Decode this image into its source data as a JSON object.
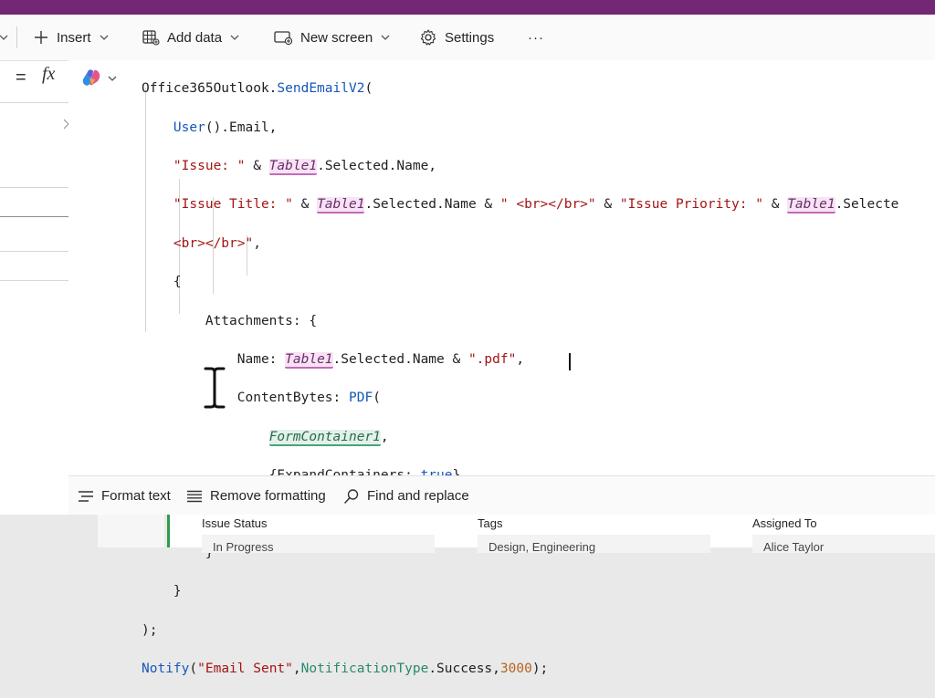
{
  "toolbar": {
    "insert_label": "Insert",
    "add_data_label": "Add data",
    "new_screen_label": "New screen",
    "settings_label": "Settings",
    "more_label": "···"
  },
  "formula_bar": {
    "equals": "=",
    "fx": "fx"
  },
  "bottom_bar": {
    "format_text_label": "Format text",
    "remove_formatting_label": "Remove formatting",
    "find_replace_label": "Find and replace"
  },
  "form": {
    "fields": [
      {
        "label": "Issue Status",
        "value": "In Progress"
      },
      {
        "label": "Tags",
        "value": "Design, Engineering"
      },
      {
        "label": "Assigned To",
        "value": "Alice Taylor"
      }
    ]
  },
  "code": {
    "l1_fn": "Office365Outlook.",
    "l1_method": "SendEmailV2",
    "l1_paren": "(",
    "l2_fn": "User",
    "l2_rest": "().Email,",
    "l3_str": "\"Issue: \"",
    "l3_amp": " & ",
    "table_ref": "Table1",
    "l3_rest": ".Selected.Name,",
    "l4_str1": "\"Issue Title: \"",
    "l4_amp1": " & ",
    "l4_mid": ".Selected.Name & ",
    "l4_str2": "\" <br></br>\"",
    "l4_amp2": " & ",
    "l4_str3": "\"Issue Priority: \"",
    "l4_amp3": " & ",
    "l4_tail": ".Selecte",
    "l5_str": "<br></br>\"",
    "l5_rest": ",",
    "l6": "{",
    "l7": "Attachments: {",
    "l8_key": "Name: ",
    "l8_mid": ".Selected.Name & ",
    "l8_str": "\".pdf\"",
    "l8_end": ",",
    "l9_key": "ContentBytes: ",
    "l9_fn": "PDF",
    "l9_paren": "(",
    "control_ref": "FormContainer1",
    "l10_end": ",",
    "l11_open": "{ExpandContainers: ",
    "l11_kw": "true",
    "l11_close": "}",
    "l12": ")",
    "l13": "}",
    "l14": "}",
    "l15": ");",
    "l16_fn": "Notify",
    "l16_open": "(",
    "l16_str": "\"Email Sent\"",
    "l16_comma1": ",",
    "l16_enum": "NotificationType",
    "l16_dot": ".Success,",
    "l16_num": "3000",
    "l16_end": ");"
  },
  "colors": {
    "title_bar": "#742774",
    "function": "#1557b8",
    "string": "#a31515",
    "number": "#b5651d",
    "table_highlight": "#f7e3f4",
    "control_highlight": "#e2f1ea"
  }
}
